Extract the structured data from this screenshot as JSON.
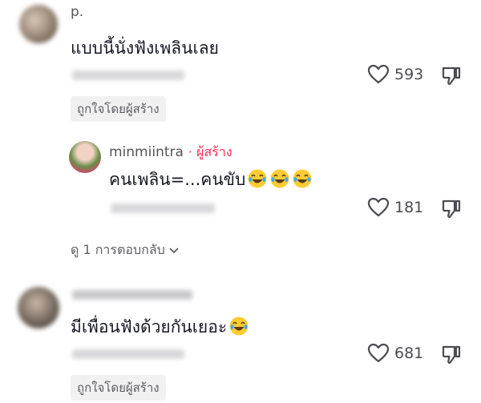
{
  "colors": {
    "accent": "#fe2c55",
    "text": "#161823",
    "muted": "#8a8b91",
    "chip_bg": "#f1f1f2"
  },
  "comments": [
    {
      "username": "p.",
      "text": "แบบนี้นั่งฟังเพลินเลย",
      "likes": "593",
      "creator_liked": "ถูกใจโดยผู้สร้าง"
    },
    {
      "username": "",
      "text": "มีเพื่อนฟังด้วยกันเยอะ",
      "likes": "681",
      "creator_liked": "ถูกใจโดยผู้สร้าง"
    }
  ],
  "reply": {
    "username": "minmiintra",
    "author_label": "· ผู้สร้าง",
    "text": "คนเพลิน=...คนขับ",
    "likes": "181"
  },
  "view_replies_label": "ดู 1 การตอบกลับ",
  "icons": {
    "like": "heart-outline-icon",
    "dislike": "thumbs-down-icon",
    "expand": "chevron-down-icon",
    "emoji": "laughing-tears-emoji"
  }
}
